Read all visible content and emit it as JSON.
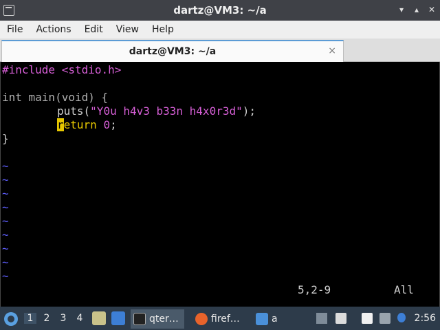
{
  "window": {
    "title": "dartz@VM3: ~/a",
    "controls": [
      "minimize",
      "maximize",
      "close"
    ]
  },
  "menu": [
    "File",
    "Actions",
    "Edit",
    "View",
    "Help"
  ],
  "tab": {
    "label": "dartz@VM3: ~/a",
    "close": "×"
  },
  "editor": {
    "include_line": "#include <stdio.h>",
    "main_line": "int main(void) {",
    "puts_fn": "puts(",
    "puts_str": "\"Y0u h4v3 b33n h4x0r3d\"",
    "puts_end": ");",
    "return_first": "r",
    "return_rest": "eturn",
    "return_num": "0",
    "return_end": ";",
    "close_brace": "}",
    "tilde": "~",
    "position": "5,2-9",
    "scroll": "All"
  },
  "taskbar": {
    "desktops": [
      "1",
      "2",
      "3",
      "4"
    ],
    "tasks": [
      {
        "label": "qter…"
      },
      {
        "label": "firef…"
      },
      {
        "label": "a"
      }
    ],
    "clock": "2:56"
  },
  "colors": {
    "preproc": "#d75fd7",
    "keyword": "#e6c700",
    "tilde": "#5f5fff",
    "taskbar": "#2d3b4a"
  }
}
